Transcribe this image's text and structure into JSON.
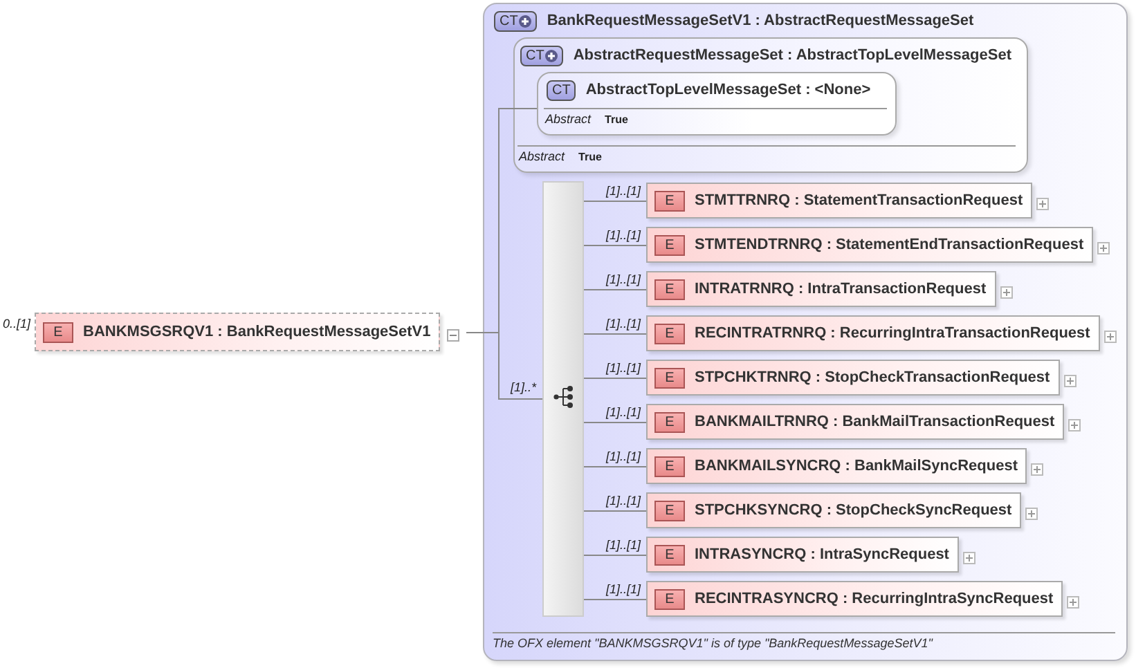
{
  "root": {
    "occurrence": "0..[1]",
    "badge": "E",
    "title": "BANKMSGSRQV1 : BankRequestMessageSetV1",
    "expanded": true
  },
  "complex_type": {
    "badge": "CT",
    "derived": true,
    "title": "BankRequestMessageSetV1 : AbstractRequestMessageSet",
    "parent": {
      "badge": "CT",
      "derived": true,
      "title": "AbstractRequestMessageSet : AbstractTopLevelMessageSet",
      "property": {
        "label": "Abstract",
        "value": "True"
      },
      "parent": {
        "badge": "CT",
        "derived": false,
        "title": "AbstractTopLevelMessageSet : <None>",
        "property": {
          "label": "Abstract",
          "value": "True"
        }
      }
    },
    "sequence": {
      "occurrence": "[1]..*",
      "elements": [
        {
          "occurrence": "[1]..[1]",
          "badge": "E",
          "title": "STMTTRNRQ : StatementTransactionRequest",
          "expanded": false
        },
        {
          "occurrence": "[1]..[1]",
          "badge": "E",
          "title": "STMTENDTRNRQ : StatementEndTransactionRequest",
          "expanded": false
        },
        {
          "occurrence": "[1]..[1]",
          "badge": "E",
          "title": "INTRATRNRQ : IntraTransactionRequest",
          "expanded": false
        },
        {
          "occurrence": "[1]..[1]",
          "badge": "E",
          "title": "RECINTRATRNRQ : RecurringIntraTransactionRequest",
          "expanded": false
        },
        {
          "occurrence": "[1]..[1]",
          "badge": "E",
          "title": "STPCHKTRNRQ : StopCheckTransactionRequest",
          "expanded": false
        },
        {
          "occurrence": "[1]..[1]",
          "badge": "E",
          "title": "BANKMAILTRNRQ : BankMailTransactionRequest",
          "expanded": false
        },
        {
          "occurrence": "[1]..[1]",
          "badge": "E",
          "title": "BANKMAILSYNCRQ : BankMailSyncRequest",
          "expanded": false
        },
        {
          "occurrence": "[1]..[1]",
          "badge": "E",
          "title": "STPCHKSYNCRQ : StopCheckSyncRequest",
          "expanded": false
        },
        {
          "occurrence": "[1]..[1]",
          "badge": "E",
          "title": "INTRASYNCRQ : IntraSyncRequest",
          "expanded": false
        },
        {
          "occurrence": "[1]..[1]",
          "badge": "E",
          "title": "RECINTRASYNCRQ : RecurringIntraSyncRequest",
          "expanded": false
        }
      ]
    },
    "description": "The OFX element \"BANKMSGSRQV1\" is of type \"BankRequestMessageSetV1\""
  }
}
